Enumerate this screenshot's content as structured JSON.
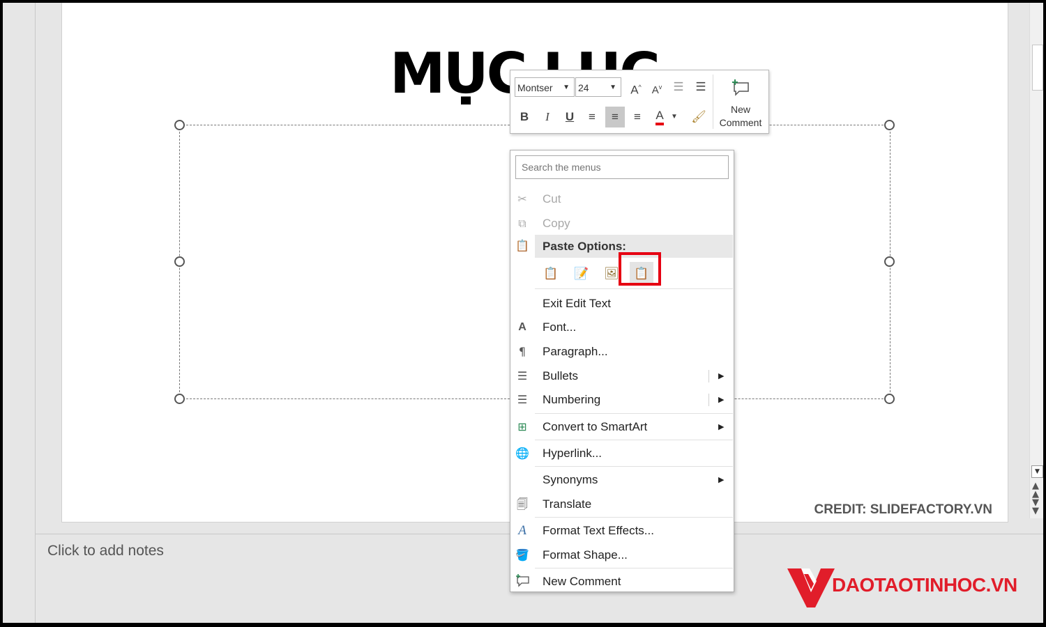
{
  "slide": {
    "title": "MỤC LỤC",
    "credit": "CREDIT: SLIDEFACTORY.VN"
  },
  "notes": {
    "placeholder": "Click to add notes"
  },
  "mini_toolbar": {
    "font_name": "Montser",
    "font_size": "24",
    "grow_font": "A",
    "shrink_font": "A",
    "bold": "B",
    "italic": "I",
    "underline": "U",
    "font_color_label": "A",
    "font_color": "#e60012",
    "new_comment_line1": "New",
    "new_comment_line2": "Comment"
  },
  "context_menu": {
    "search_placeholder": "Search the menus",
    "paste_options_label": "Paste Options:",
    "paste_buttons": [
      "use-destination-theme",
      "keep-source-formatting",
      "picture",
      "keep-text-only"
    ],
    "items": [
      {
        "label": "Cut",
        "icon": "scissors-icon",
        "enabled": false
      },
      {
        "label": "Copy",
        "icon": "copy-icon",
        "enabled": false
      },
      {
        "label": "Exit Edit Text",
        "icon": "",
        "enabled": true
      },
      {
        "label": "Font...",
        "icon": "font-icon",
        "enabled": true
      },
      {
        "label": "Paragraph...",
        "icon": "paragraph-icon",
        "enabled": true
      },
      {
        "label": "Bullets",
        "icon": "bullets-icon",
        "enabled": true,
        "submenu": true
      },
      {
        "label": "Numbering",
        "icon": "numbering-icon",
        "enabled": true,
        "submenu": true
      },
      {
        "label": "Convert to SmartArt",
        "icon": "smartart-icon",
        "enabled": true,
        "submenu": true
      },
      {
        "label": "Hyperlink...",
        "icon": "hyperlink-icon",
        "enabled": true
      },
      {
        "label": "Synonyms",
        "icon": "",
        "enabled": true,
        "submenu": true
      },
      {
        "label": "Translate",
        "icon": "translate-icon",
        "enabled": true
      },
      {
        "label": "Format Text Effects...",
        "icon": "text-effects-icon",
        "enabled": true
      },
      {
        "label": "Format Shape...",
        "icon": "format-shape-icon",
        "enabled": true
      },
      {
        "label": "New Comment",
        "icon": "new-comment-icon",
        "enabled": true
      }
    ]
  },
  "watermark": {
    "brand": "DAOTAOTINHOC.VN",
    "brand_color": "#e11d2a"
  },
  "colors": {
    "highlight": "#e60012",
    "paste_icon": "#c8902c"
  }
}
